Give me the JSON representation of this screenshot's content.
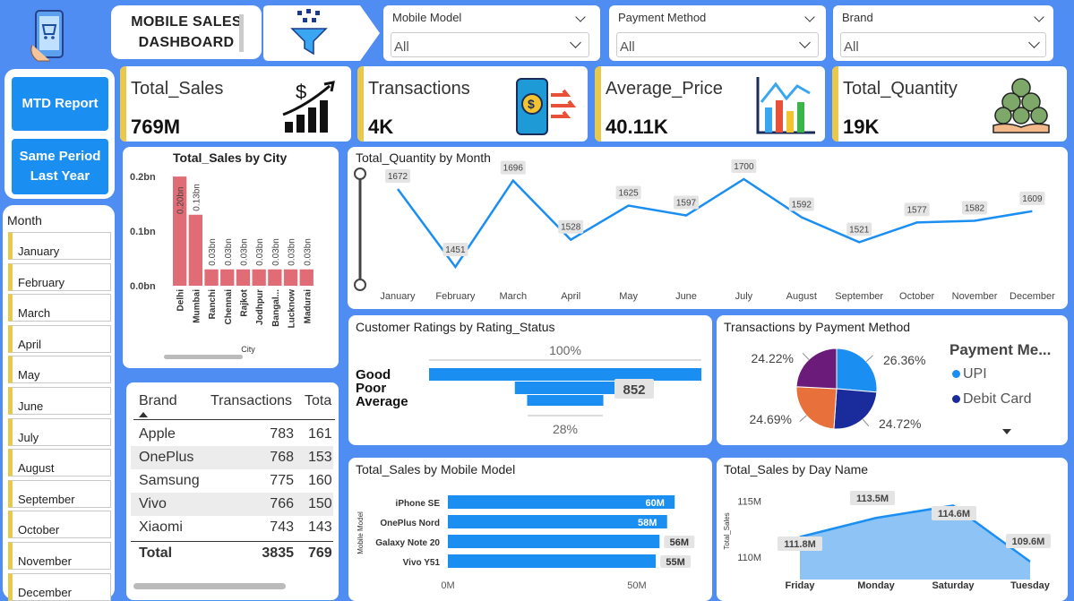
{
  "header": {
    "title_line1": "MOBILE SALES",
    "title_line2": "DASHBOARD"
  },
  "filters": [
    {
      "label": "Mobile Model",
      "value": "All"
    },
    {
      "label": "Payment Method",
      "value": "All"
    },
    {
      "label": "Brand",
      "value": "All"
    }
  ],
  "kpis": [
    {
      "label": "Total_Sales",
      "value": "769M",
      "icon": "growth-chart-icon"
    },
    {
      "label": "Transactions",
      "value": "4K",
      "icon": "phone-payment-icon"
    },
    {
      "label": "Average_Price",
      "value": "40.11K",
      "icon": "bar-chart-icon"
    },
    {
      "label": "Total_Quantity",
      "value": "19K",
      "icon": "coins-hand-icon"
    }
  ],
  "nav": {
    "mtd": "MTD Report",
    "spl_line1": "Same Period",
    "spl_line2": "Last Year"
  },
  "month_slicer": {
    "title": "Month",
    "items": [
      "January",
      "February",
      "March",
      "April",
      "May",
      "June",
      "July",
      "August",
      "September",
      "October",
      "November",
      "December"
    ]
  },
  "brand_table": {
    "headers": [
      "Brand",
      "Transactions",
      "Tota"
    ],
    "rows": [
      [
        "Apple",
        "783",
        "161"
      ],
      [
        "OnePlus",
        "768",
        "153"
      ],
      [
        "Samsung",
        "775",
        "160"
      ],
      [
        "Vivo",
        "766",
        "150"
      ],
      [
        "Xiaomi",
        "743",
        "143"
      ]
    ],
    "total": [
      "Total",
      "3835",
      "769"
    ]
  },
  "colors": {
    "accent": "#1b8ef2",
    "background": "#4f8df2",
    "city_bar": "#e06c75",
    "kpi_bar": "#e8c94c"
  },
  "chart_data": [
    {
      "type": "bar",
      "title": "Total_Sales by City",
      "xlabel": "City",
      "ylabel": "",
      "categories": [
        "Delhi",
        "Mumbai",
        "Ranchi",
        "Chennai",
        "Rajkot",
        "Jodhpur",
        "Bangal...",
        "Lucknow",
        "Madurai"
      ],
      "values": [
        0.2,
        0.13,
        0.03,
        0.03,
        0.03,
        0.03,
        0.03,
        0.03,
        0.03
      ],
      "labels": [
        "0.20bn",
        "0.13bn",
        "0.03bn",
        "0.03bn",
        "0.03bn",
        "0.03bn",
        "0.03bn",
        "0.03bn",
        "0.03bn"
      ],
      "yticks": [
        "0.2bn",
        "0.1bn",
        "0.0bn"
      ],
      "ylim": [
        0,
        0.21
      ]
    },
    {
      "type": "line",
      "title": "Total_Quantity by Month",
      "categories": [
        "January",
        "February",
        "March",
        "April",
        "May",
        "June",
        "July",
        "August",
        "September",
        "October",
        "November",
        "December"
      ],
      "values": [
        1672,
        1451,
        1696,
        1528,
        1625,
        1597,
        1700,
        1592,
        1521,
        1577,
        1582,
        1609
      ]
    },
    {
      "type": "bar",
      "title": "Customer Ratings by Rating_Status",
      "categories": [
        "Good",
        "Poor",
        "Average"
      ],
      "values": [
        100,
        37,
        28
      ],
      "labels": [
        "100%",
        "852",
        "28%"
      ]
    },
    {
      "type": "pie",
      "title": "Transactions by Payment Method",
      "legend_title": "Payment Me...",
      "legend": [
        "UPI",
        "Debit Card"
      ],
      "values": [
        26.36,
        24.72,
        24.69,
        24.22
      ],
      "labels": [
        "26.36%",
        "24.72%",
        "24.69%",
        "24.22%"
      ],
      "colors": [
        "#1b8ef2",
        "#1a2c9c",
        "#e8703a",
        "#6b1b7a"
      ]
    },
    {
      "type": "bar",
      "title": "Total_Sales by Mobile Model",
      "ylabel": "Mobile Model",
      "categories": [
        "iPhone SE",
        "OnePlus Nord",
        "Galaxy Note 20",
        "Vivo Y51"
      ],
      "values": [
        60,
        58,
        56,
        55
      ],
      "labels": [
        "60M",
        "58M",
        "56M",
        "55M"
      ],
      "xticks": [
        "0M",
        "50M"
      ]
    },
    {
      "type": "area",
      "title": "Total_Sales by Day Name",
      "ylabel": "Total_Sales",
      "categories": [
        "Friday",
        "Monday",
        "Saturday",
        "Tuesday"
      ],
      "values": [
        111.8,
        113.5,
        114.6,
        109.6
      ],
      "labels": [
        "111.8M",
        "113.5M",
        "114.6M",
        "109.6M"
      ],
      "yticks": [
        "115M",
        "110M"
      ],
      "ylim": [
        108,
        116
      ]
    }
  ]
}
